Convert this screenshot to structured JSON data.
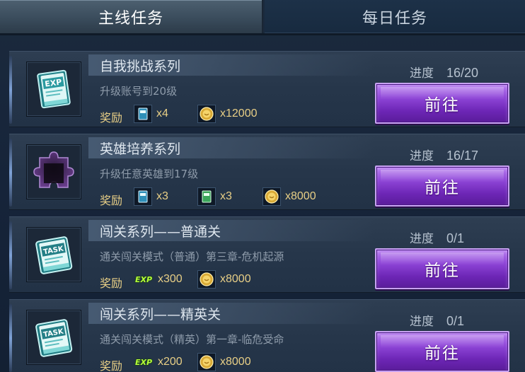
{
  "tabs": {
    "main": "主线任务",
    "daily": "每日任务"
  },
  "reward_label": "奖励",
  "progress_label": "进度",
  "go_label": "前往",
  "colors": {
    "go_button": "#8f46d8",
    "reward_text": "#e8cf86",
    "active_tab": "#3a4c5c"
  },
  "tasks": [
    {
      "title": "自我挑战系列",
      "desc": "升级账号到20级",
      "progress": "16/20",
      "icon": "exp-book-icon",
      "rewards": [
        {
          "icon": "exp-book-icon",
          "count": "x4"
        },
        {
          "icon": "gold-coin-icon",
          "count": "x12000"
        }
      ]
    },
    {
      "title": "英雄培养系列",
      "desc": "升级任意英雄到17级",
      "progress": "16/17",
      "icon": "puzzle-piece-icon",
      "rewards": [
        {
          "icon": "exp-book-icon",
          "count": "x3"
        },
        {
          "icon": "green-exp-book-icon",
          "count": "x3"
        },
        {
          "icon": "gold-coin-icon",
          "count": "x8000"
        }
      ]
    },
    {
      "title": "闯关系列——普通关",
      "desc": "通关闯关模式（普通）第三章-危机起源",
      "progress": "0/1",
      "icon": "task-book-icon",
      "rewards": [
        {
          "icon": "exp-text-icon",
          "count": "x300",
          "text": "EXP"
        },
        {
          "icon": "gold-coin-icon",
          "count": "x8000"
        }
      ]
    },
    {
      "title": "闯关系列——精英关",
      "desc": "通关闯关模式（精英）第一章-临危受命",
      "progress": "0/1",
      "icon": "task-book-icon",
      "rewards": [
        {
          "icon": "exp-text-icon",
          "count": "x200",
          "text": "EXP"
        },
        {
          "icon": "gold-coin-icon",
          "count": "x8000"
        }
      ]
    }
  ]
}
